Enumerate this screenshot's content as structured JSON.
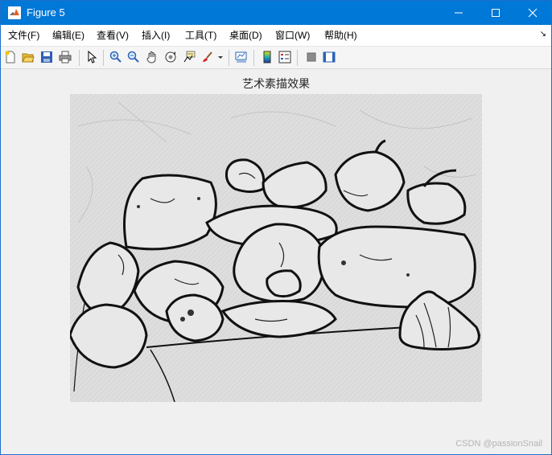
{
  "window": {
    "title": "Figure 5",
    "controls": [
      "minimize",
      "maximize",
      "close"
    ]
  },
  "menubar": {
    "items": [
      {
        "label": "文件(F)"
      },
      {
        "label": "编辑(E)"
      },
      {
        "label": "查看(V)"
      },
      {
        "label": "插入(I)"
      },
      {
        "label": "工具(T)"
      },
      {
        "label": "桌面(D)"
      },
      {
        "label": "窗口(W)"
      },
      {
        "label": "帮助(H)"
      }
    ],
    "overflow_arrow": "↘"
  },
  "toolbar": {
    "icons": [
      "new-figure-icon",
      "open-file-icon",
      "save-icon",
      "print-icon",
      "pointer-icon",
      "zoom-in-icon",
      "zoom-out-icon",
      "pan-icon",
      "rotate-3d-icon",
      "data-cursor-icon",
      "brush-icon",
      "link-plot-icon",
      "colorbar-icon",
      "legend-icon",
      "hide-plot-tools-icon",
      "show-plot-tools-icon"
    ]
  },
  "figure": {
    "axes_title": "艺术素描效果",
    "image_description_icon": "pepper-sketch-image"
  },
  "watermark": "CSDN @passionSnail",
  "colors": {
    "titlebar": "#0078d7",
    "background": "#f0f0f0"
  }
}
